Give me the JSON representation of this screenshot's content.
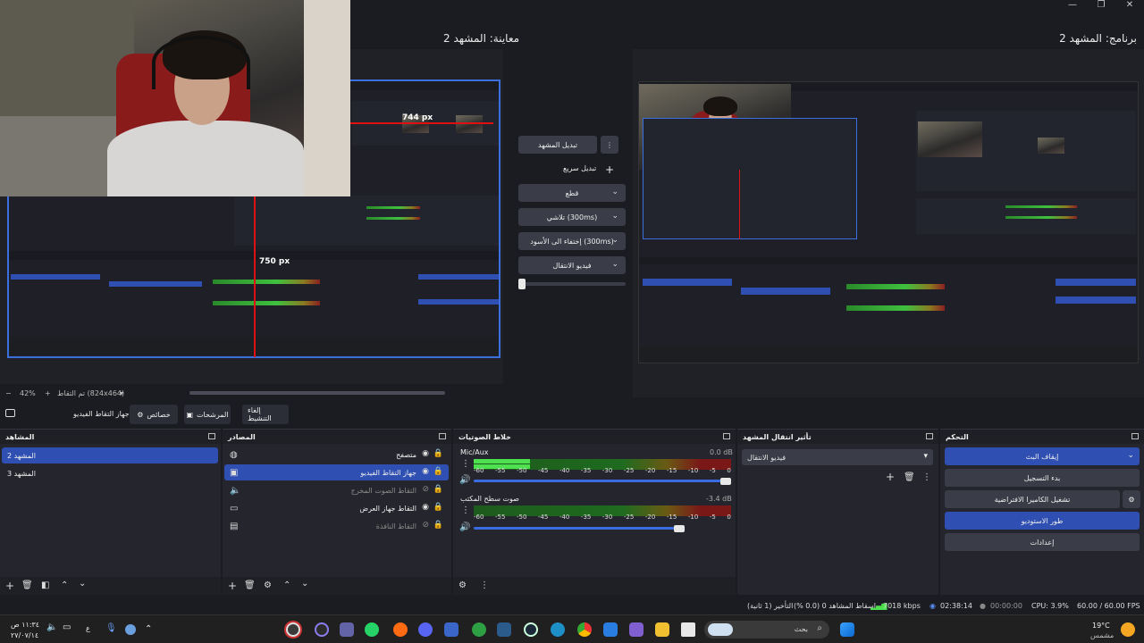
{
  "window": {
    "minimize": "—",
    "restore": "❐",
    "close": "✕"
  },
  "studio": {
    "preview_title": "معاينة: المشهد 2",
    "program_title": "برنامج: المشهد 2",
    "preview_width_label": "744 px",
    "preview_height_label": "750 px",
    "zoom": "42%",
    "zoom_info": "تم التقاط (824x464)"
  },
  "transition": {
    "change_scene": "تبديل المشهد",
    "quick_transitions": "تبديل سريع",
    "quick_list": [
      "قطع",
      "تلاشي (300ms)",
      "إختفاء الى الأسود (300ms)",
      "فيديو الانتقال"
    ],
    "more_icon": "more-vert-icon",
    "add_icon": "plus-icon"
  },
  "source_toolbar": {
    "source_name": "جهاز التقاط الفيديو",
    "properties": "خصائص",
    "filters": "المرشحات",
    "deactivate": "إلغاء التنشيط"
  },
  "scenes": {
    "title": "المشاهد",
    "items": [
      {
        "name": "المشهد 2",
        "selected": true
      },
      {
        "name": "المشهد 3",
        "selected": false
      }
    ]
  },
  "sources": {
    "title": "المصادر",
    "items": [
      {
        "name": "متصفح",
        "icon": "globe-icon",
        "visible": true,
        "selected": false
      },
      {
        "name": "جهاز التقاط الفيديو",
        "icon": "camera-icon",
        "visible": true,
        "selected": true
      },
      {
        "name": "التقاط الصوت المخرج",
        "icon": "speaker-icon",
        "visible": false,
        "selected": false
      },
      {
        "name": "التقاط جهاز العرض",
        "icon": "monitor-icon",
        "visible": true,
        "selected": false
      },
      {
        "name": "التقاط النافذة",
        "icon": "window-icon",
        "visible": false,
        "selected": false
      }
    ]
  },
  "mixer": {
    "title": "خلاط الصوتيات",
    "scale": [
      "-60",
      "-55",
      "-50",
      "-45",
      "-40",
      "-35",
      "-30",
      "-25",
      "-20",
      "-15",
      "-10",
      "-5",
      "0"
    ],
    "channels": [
      {
        "name": "Mic/Aux",
        "db": "0.0 dB",
        "level": 0.22,
        "volume": 1.0
      },
      {
        "name": "صوت سطح المكتب",
        "db": "-3.4 dB",
        "level": 0.0,
        "volume": 0.82
      }
    ]
  },
  "transitions_dock": {
    "title": "تأثير انتقال المشهد",
    "selected": "فيديو الانتقال"
  },
  "controls": {
    "title": "التحكم",
    "stop_stream": "إيقاف البث",
    "start_recording": "بدء التسجيل",
    "start_virtual_cam": "تشغيل الكاميرا الافتراضية",
    "studio_mode": "طور الاستوديو",
    "settings": "إعدادات"
  },
  "status": {
    "fps": "60.00 / 60.00 FPS",
    "cpu": "CPU: 3.9%",
    "rec_time": "00:00:00",
    "stream_time": "02:38:14",
    "bitrate": "7018 kbps",
    "dropped": "إسقاط المشاهد 0 (0.0 %)",
    "delay": "التأخير (1 ثانية)"
  },
  "taskbar": {
    "search": "بحث",
    "weather_temp": "19°C",
    "weather_desc": "مشمس",
    "time": "١١:٣٤ ص",
    "date": "٢٧/٠٧/١٤",
    "lang": "ع",
    "colors": {
      "accent": "#2f4fb2",
      "red": "#d11111"
    }
  }
}
